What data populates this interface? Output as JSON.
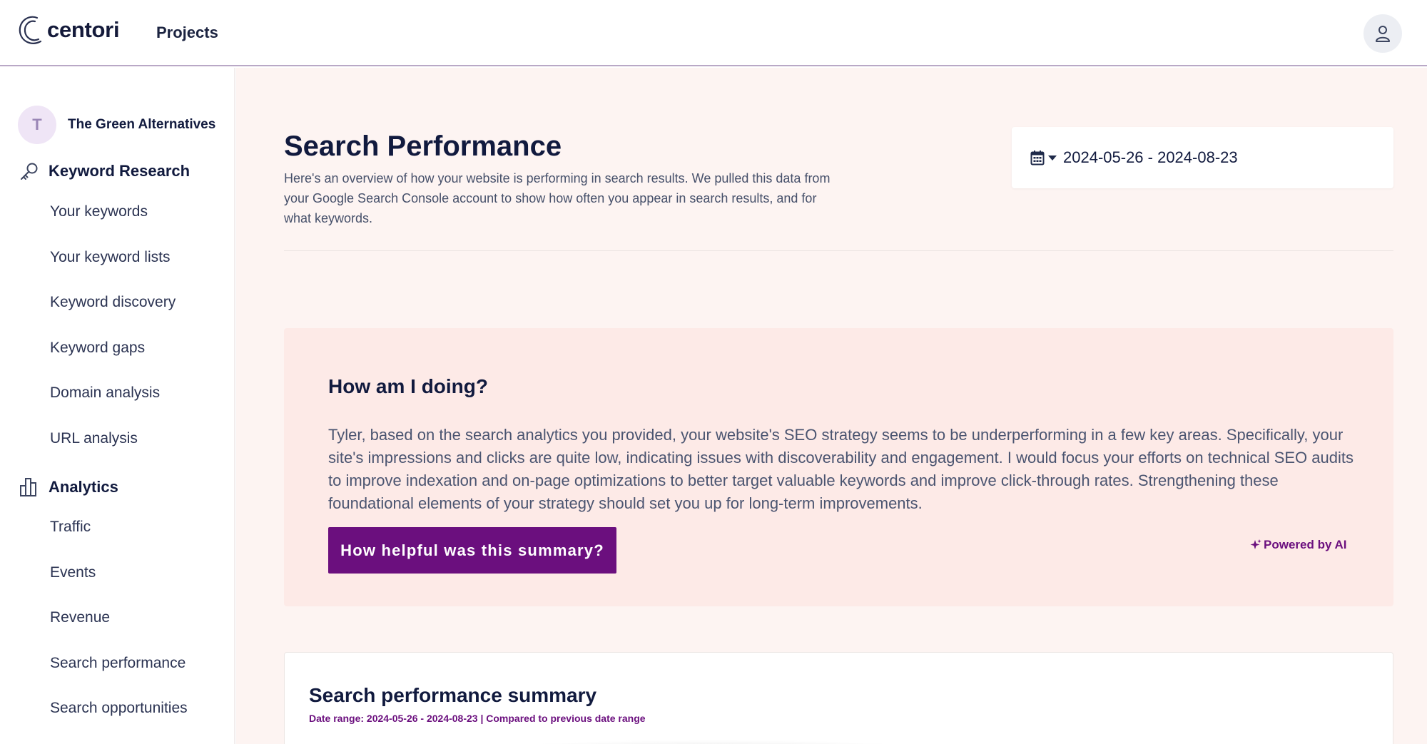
{
  "header": {
    "logo_text": "centori",
    "nav_projects": "Projects",
    "icons": {
      "logo": "centori-logo-icon",
      "user": "user-icon"
    }
  },
  "sidebar": {
    "project": {
      "initial": "T",
      "name": "The Green Alternatives"
    },
    "keyword_research": {
      "title": "Keyword Research",
      "icon": "key-icon",
      "items": [
        "Your keywords",
        "Your keyword lists",
        "Keyword discovery",
        "Keyword gaps",
        "Domain analysis",
        "URL analysis"
      ]
    },
    "analytics": {
      "title": "Analytics",
      "icon": "bar-chart-icon",
      "items": [
        "Traffic",
        "Events",
        "Revenue",
        "Search performance",
        "Search opportunities"
      ]
    }
  },
  "main": {
    "title": "Search Performance",
    "description": "Here's an overview of how your website is performing in search results. We pulled this data from your Google Search Console account to show how often you appear in search results, and for what keywords.",
    "date_range": "2024-05-26 - 2024-08-23",
    "summary": {
      "title": "How am I doing?",
      "body": "Tyler, based on the search analytics you provided, your website's SEO strategy seems to be underperforming in a few key areas. Specifically, your site's impressions and clicks are quite low, indicating issues with discoverability and engagement. I would focus your efforts on technical SEO audits to improve indexation and on-page optimizations to better target valuable keywords and improve click-through rates. Strengthening these foundational elements of your strategy should set you up for long-term improvements.",
      "button_label": "How helpful was this summary?",
      "powered_label": "Powered by AI"
    },
    "perf_summary": {
      "title": "Search performance summary",
      "subtitle": "Date range: 2024-05-26 - 2024-08-23 | Compared to previous date range"
    }
  },
  "colors": {
    "accent": "#6b0f7e",
    "navy": "#111a3e",
    "main_bg": "#fdf4f2",
    "card_bg": "#fdeae7"
  }
}
